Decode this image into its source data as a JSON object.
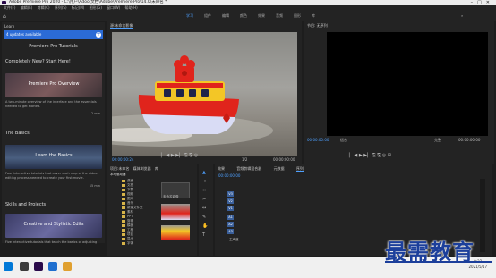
{
  "window": {
    "title": "Adobe Premiere Pro 2020 - C:\\用户\\Adoo\\文档\\Adobe\\Premiere Pro\\14.0\\未命名 *"
  },
  "menu": [
    "文件(F)",
    "编辑(E)",
    "剪辑(C)",
    "序列(S)",
    "标记(M)",
    "图形(G)",
    "窗口(W)",
    "帮助(H)"
  ],
  "workspaces": [
    "学习",
    "组件",
    "编辑",
    "颜色",
    "效果",
    "音频",
    "图形",
    "库"
  ],
  "learn": {
    "header": "Learn",
    "updates_label": "4 updates available",
    "title": "Premiere Pro Tutorials",
    "section1": "Completely New? Start Here!",
    "tutorial1": {
      "label": "Premiere Pro Overview",
      "desc": "A two-minute overview of the interface and the essentials needed to get started.",
      "duration": "2 min"
    },
    "section2": "The Basics",
    "tutorial2": {
      "label": "Learn the Basics",
      "desc": "Four interactive tutorials that cover each step of the video editing process needed to create your first movie.",
      "duration": "15 min"
    },
    "section3": "Skills and Projects",
    "tutorial3": {
      "label": "Creative and Stylistic Edits",
      "desc": "Five interactive tutorials that teach the basics of adjusting clip speed, adding titles and transitions, adjusting audio, and color correction."
    }
  },
  "source": {
    "tab": "源:未命名影像",
    "timecode_left": "00:00:00:24",
    "timecode_right": "00:00:00:00",
    "fraction": "1/2"
  },
  "program": {
    "tab": "节目: 无序列",
    "timecode_left": "00:00:00:00",
    "fit": "适合",
    "fraction": "完整",
    "timecode_right": "00:00:00:00"
  },
  "project": {
    "tabs": [
      "项目:未命名",
      "媒体浏览器",
      "库",
      "信息"
    ],
    "path": "本地驱动器",
    "items": [
      "桌面",
      "文档",
      "下载",
      "视频",
      "图片",
      "音乐",
      "新建文件夹",
      "素材",
      "PPT",
      "剪辑",
      "模板",
      "工程",
      "项目",
      "导出",
      "字体",
      "备份"
    ],
    "clips": [
      "未命名影像",
      "未命名影像2",
      "未命名影像3",
      "未命名影像4"
    ]
  },
  "timeline": {
    "tabs": [
      "效果",
      "音频剪辑混合器",
      "元数据",
      "序列"
    ],
    "timecode": "00:00:00:00",
    "tracks": [
      "V3",
      "V2",
      "V1",
      "A1",
      "A2",
      "A3"
    ],
    "master": "主声道"
  },
  "taskbar": {
    "time": "9:22",
    "date": "2021/5/17"
  },
  "watermark": "最需教育",
  "colors": {
    "accent": "#4ea0ff",
    "update_blue": "#2b6bd6",
    "panel": "#232323",
    "folder": "#d7b449",
    "boat_red": "#e0241c",
    "boat_yellow": "#f3c626",
    "watermark": "#1c3f9b"
  }
}
